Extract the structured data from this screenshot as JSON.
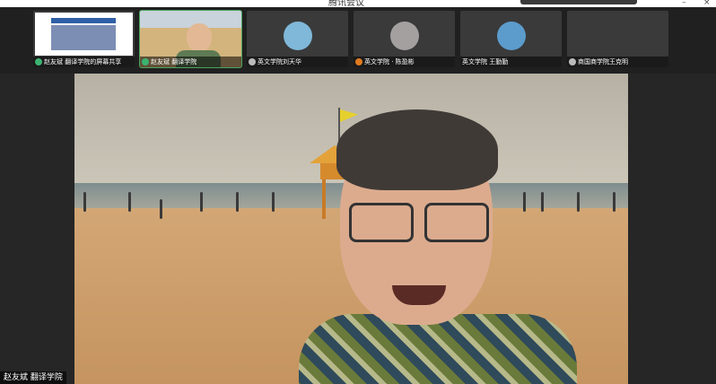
{
  "window": {
    "title": "腾讯会议"
  },
  "participants": [
    {
      "label": "赵友斌 翻译学院的屏幕共享",
      "mic": "green",
      "type": "screen-share"
    },
    {
      "label": "赵友斌 翻译学院",
      "mic": "green",
      "type": "video",
      "active": true
    },
    {
      "label": "英文学院刘天华",
      "mic": "gray",
      "type": "avatar",
      "avatar_color": "#7fb8d8"
    },
    {
      "label": "英文学院 · 陈盈彬",
      "mic": "orange",
      "type": "avatar",
      "avatar_color": "#a4a0a0"
    },
    {
      "label": "英文学院 王勤勤",
      "mic": "none",
      "type": "avatar",
      "avatar_color": "#5b9ccc"
    },
    {
      "label": "商国商学院王克明",
      "mic": "gray",
      "type": "avatar",
      "avatar_color": "#3a3a3a"
    }
  ],
  "main_video": {
    "speaker_label": "赵友斌 翻译学院"
  }
}
